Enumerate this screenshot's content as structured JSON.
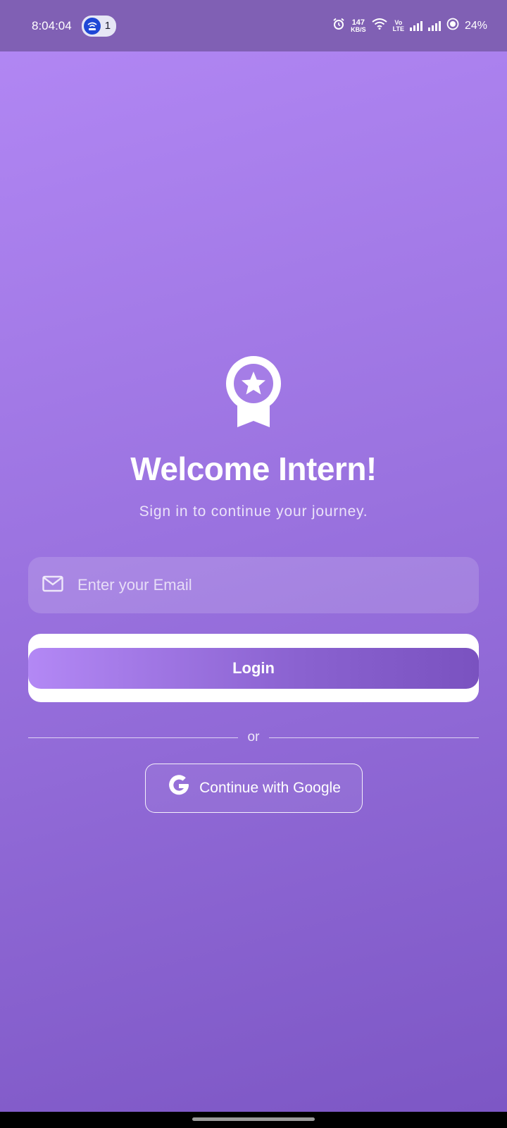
{
  "status_bar": {
    "time": "8:04:04",
    "notification_count": "1",
    "net_speed_value": "147",
    "net_speed_unit": "KB/S",
    "volte_top": "Vo",
    "volte_bottom": "LTE",
    "battery": "24%"
  },
  "login": {
    "title": "Welcome Intern!",
    "subtitle": "Sign in to continue your journey.",
    "email_placeholder": "Enter your Email",
    "email_value": "",
    "login_label": "Login",
    "divider_text": "or",
    "google_label": "Continue with Google"
  },
  "icons": {
    "logo": "award-badge-icon",
    "email": "mail-icon",
    "google": "google-g-icon"
  },
  "colors": {
    "gradient_top": "#b388f5",
    "gradient_bottom": "#7c56c4",
    "status_bar": "#8060b4",
    "text": "#ffffff"
  }
}
